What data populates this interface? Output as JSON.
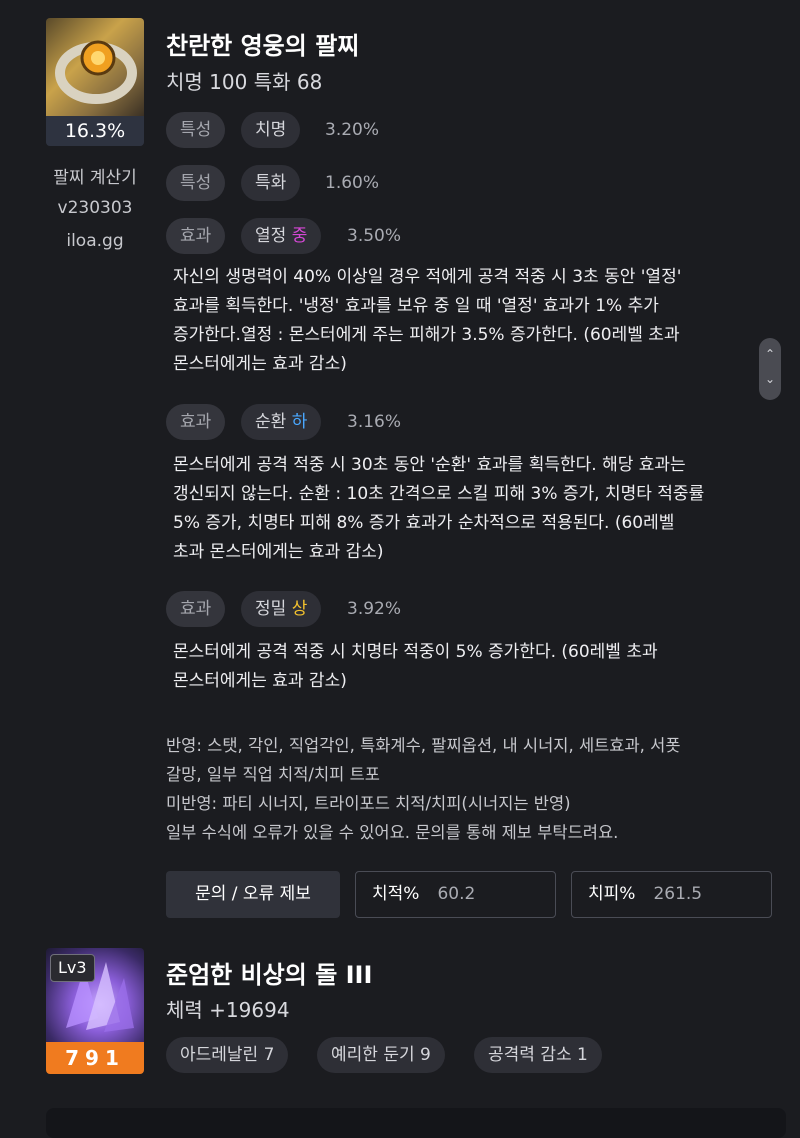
{
  "bracelet": {
    "percent": "16.3%",
    "name": "찬란한 영웅의 팔찌",
    "stats": "치명 100  특화 68",
    "calc": {
      "line1": "팔찌 계산기",
      "line2": "v230303",
      "line3": "iloa.gg"
    },
    "rows": [
      {
        "kind": "특성",
        "name": "치명",
        "value": "3.20%"
      },
      {
        "kind": "특성",
        "name": "특화",
        "value": "1.60%"
      },
      {
        "kind": "효과",
        "name": "열정",
        "grade": "중",
        "value": "3.50%",
        "desc": [
          "자신의 생명력이 40% 이상일 경우 적에게 공격 적중 시 3초 동안 '열정'",
          "효과를 획득한다. '냉정' 효과를 보유 중 일 때 '열정' 효과가 1% 추가",
          "증가한다.열정 : 몬스터에게 주는 피해가 3.5% 증가한다. (60레벨 초과",
          "몬스터에게는 효과 감소)"
        ]
      },
      {
        "kind": "효과",
        "name": "순환",
        "grade": "하",
        "value": "3.16%",
        "desc": [
          "몬스터에게 공격 적중 시 30초 동안 '순환' 효과를 획득한다. 해당 효과는",
          "갱신되지 않는다. 순환 : 10초 간격으로 스킬 피해 3% 증가, 치명타 적중률",
          "5% 증가, 치명타 피해 8% 증가 효과가 순차적으로 적용된다. (60레벨",
          "초과 몬스터에게는 효과 감소)"
        ]
      },
      {
        "kind": "효과",
        "name": "정밀",
        "grade": "상",
        "value": "3.92%",
        "desc": [
          "몬스터에게 공격 적중 시 치명타 적중이 5% 증가한다. (60레벨 초과",
          "몬스터에게는 효과 감소)"
        ]
      }
    ],
    "notes": [
      "반영: 스탯, 각인, 직업각인, 특화계수, 팔찌옵션, 내 시너지, 세트효과, 서폿",
      "갈망, 일부 직업 치적/치피 트포",
      "미반영: 파티 시너지, 트라이포드 치적/치피(시너지는 반영)",
      "일부 수식에 오류가 있을 수 있어요. 문의를 통해 제보 부탁드려요."
    ],
    "report_button": "문의 / 오류 제보",
    "crit_rate": {
      "label": "치적%",
      "value": "60.2"
    },
    "crit_dmg": {
      "label": "치피%",
      "value": "261.5"
    }
  },
  "stone": {
    "level": "Lv3",
    "number": "791",
    "name": "준엄한 비상의 돌 III",
    "stat": "체력 +19694",
    "engravings": [
      "아드레날린 7",
      "예리한 둔기 9",
      "공격력 감소 1"
    ]
  },
  "colors": {
    "grade_mid": "#d548d6",
    "grade_low": "#4aa8ff",
    "grade_high": "#f2c12e",
    "stone_badge": "#f07b1f"
  }
}
